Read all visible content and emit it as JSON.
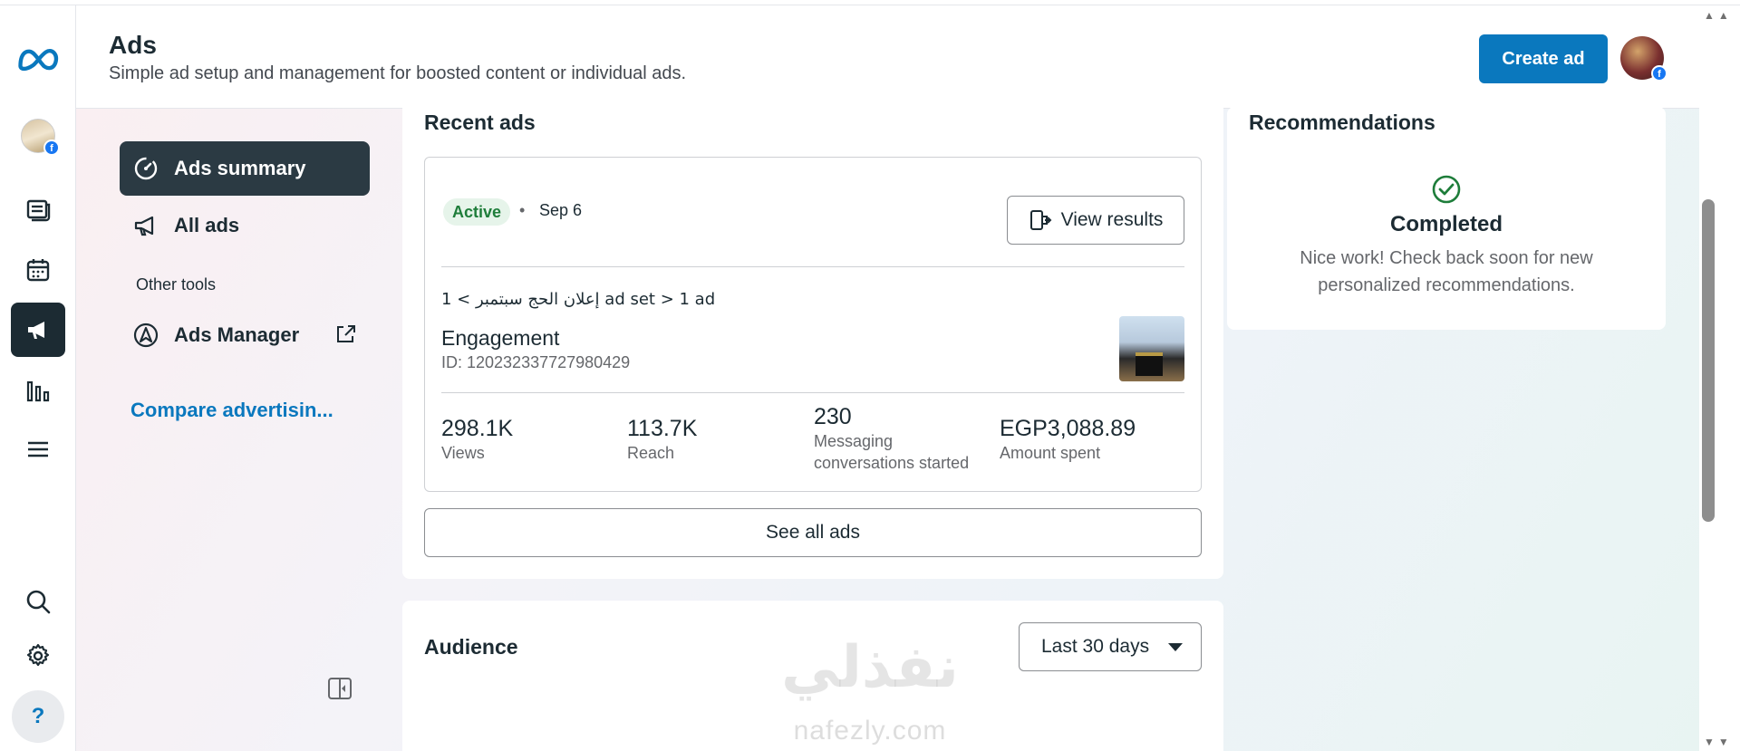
{
  "header": {
    "title": "Ads",
    "subtitle": "Simple ad setup and management for boosted content or individual ads.",
    "create_label": "Create ad"
  },
  "rail": {
    "icons": [
      "meta-logo-icon",
      "page-avatar",
      "news-feed-icon",
      "calendar-icon",
      "megaphone-icon",
      "insights-icon",
      "menu-icon",
      "search-icon",
      "gear-icon",
      "help-icon"
    ],
    "help_label": "?"
  },
  "sidenav": {
    "items": [
      {
        "label": "Ads summary",
        "icon": "ads-summary-icon",
        "active": true
      },
      {
        "label": "All ads",
        "icon": "megaphone-icon",
        "active": false
      }
    ],
    "other_tools_label": "Other tools",
    "ads_manager_label": "Ads Manager",
    "compare_label": "Compare advertisin..."
  },
  "recent_ads": {
    "title": "Recent ads",
    "status": "Active",
    "separator": "•",
    "date": "Sep 6",
    "view_results_label": "View results",
    "breadcrumb": "إعلان الحج سبتمبر > 1 ad set > 1 ad",
    "objective": "Engagement",
    "ad_id": "ID: 120232337727980429",
    "metrics": [
      {
        "value": "298.1K",
        "label": "Views"
      },
      {
        "value": "113.7K",
        "label": "Reach"
      },
      {
        "value": "230",
        "label": "Messaging conversations started"
      },
      {
        "value": "EGP3,088.89",
        "label": "Amount spent"
      }
    ],
    "see_all_label": "See all ads"
  },
  "audience": {
    "title": "Audience",
    "range_label": "Last 30 days"
  },
  "recommendations": {
    "title": "Recommendations",
    "status": "Completed",
    "message": "Nice work! Check back soon for new personalized recommendations."
  },
  "watermark": {
    "arabic": "نفذلي",
    "latin": "nafezly.com"
  },
  "colors": {
    "accent": "#0a78be",
    "active_nav": "#2b3a43",
    "success": "#1e7d3a"
  }
}
